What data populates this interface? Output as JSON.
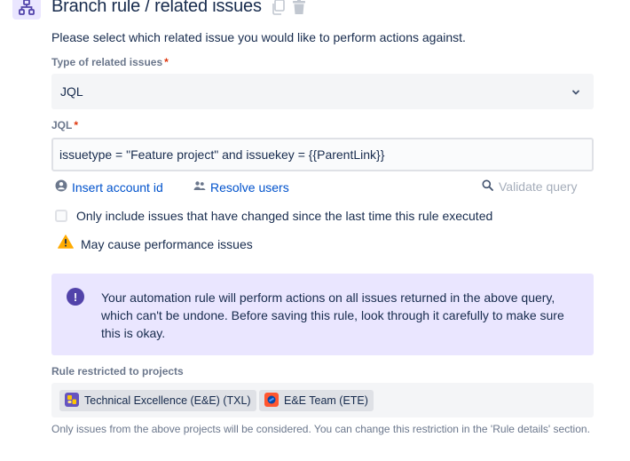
{
  "header": {
    "title": "Branch rule / related issues",
    "icon": "branch-icon",
    "actions": [
      "copy-icon",
      "trash-icon"
    ]
  },
  "description": "Please select which related issue you would like to perform actions against.",
  "type_field": {
    "label": "Type of related issues",
    "required_mark": "*",
    "value": "JQL"
  },
  "jql_field": {
    "label": "JQL",
    "required_mark": "*",
    "value": "issuetype = \"Feature project\" and issuekey = {{ParentLink}}"
  },
  "links": {
    "insert_account_id": "Insert account id",
    "resolve_users": "Resolve users",
    "validate_query": "Validate query"
  },
  "checkbox": {
    "label": "Only include issues that have changed since the last time this rule executed",
    "checked": false
  },
  "warning": {
    "text": "May cause performance issues"
  },
  "info_panel": {
    "text": "Your automation rule will perform actions on all issues returned in the above query, which can't be undone. Before saving this rule, look through it carefully to make sure this is okay."
  },
  "projects": {
    "label": "Rule restricted to projects",
    "items": [
      {
        "name": "Technical Excellence (E&E) (TXL)"
      },
      {
        "name": "E&E Team (ETE)"
      }
    ],
    "note": "Only issues from the above projects will be considered. You can change this restriction in the 'Rule details' section."
  },
  "colors": {
    "accent_purple": "#5243aa",
    "panel_purple": "#eae6ff",
    "link_blue": "#0052cc",
    "required_red": "#de350b",
    "warning_yellow": "#ffab00"
  }
}
